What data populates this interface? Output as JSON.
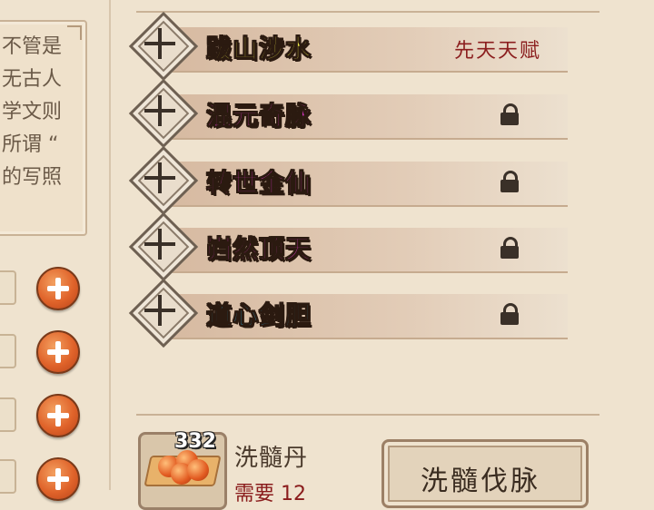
{
  "left_panel": {
    "lines": [
      "不管是",
      "无古人",
      "学文则",
      "所谓 “",
      "的写照"
    ]
  },
  "talents": [
    {
      "name": "跋山涉水",
      "color": "#f2f04a",
      "status": "先天天赋",
      "locked": false
    },
    {
      "name": "混元奇脉",
      "color": "#ec3ad8",
      "status": "",
      "locked": true
    },
    {
      "name": "转世金仙",
      "color": "#ec3ad8",
      "status": "",
      "locked": true
    },
    {
      "name": "岿然顶天",
      "color": "#ec3ad8",
      "status": "",
      "locked": true
    },
    {
      "name": "道心剑胆",
      "color": "#2bb8f0",
      "status": "",
      "locked": true
    }
  ],
  "item": {
    "count": "332",
    "name": "洗髓丹",
    "need": "需要 12"
  },
  "action_button": {
    "label": "洗髓伐脉"
  }
}
